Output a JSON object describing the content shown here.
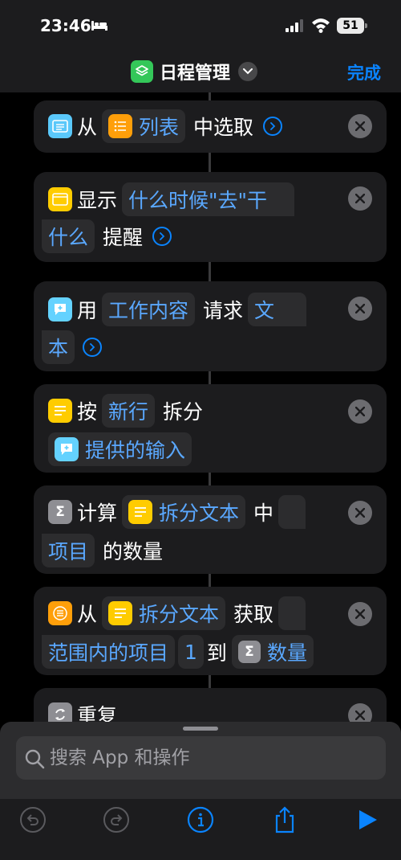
{
  "status_bar": {
    "time": "23:46",
    "battery": "51"
  },
  "nav": {
    "title": "日程管理",
    "done_label": "完成"
  },
  "actions": [
    {
      "text1": "从",
      "token1": "列表",
      "text2": "中选取"
    },
    {
      "text1": "显示",
      "token1_line1": "什么时候\"去\"干",
      "token1_line2": "什么",
      "text2": "提醒"
    },
    {
      "text1": "用",
      "token1": "工作内容",
      "text2": "请求",
      "token2_line1": "文",
      "token2_line2": "本"
    },
    {
      "text1": "按",
      "token1": "新行",
      "text2": "拆分",
      "token2": "提供的输入"
    },
    {
      "text1": "计算",
      "token1": "拆分文本",
      "text2": "中",
      "token2": "项目",
      "text3": "的数量"
    },
    {
      "text1": "从",
      "token1": "拆分文本",
      "text2": "获取",
      "token2": "范围内的项目",
      "token3": "1",
      "text3": "到",
      "token4": "数量"
    },
    {
      "text1": "重复"
    }
  ],
  "search": {
    "placeholder": "搜索 App 和操作"
  },
  "icons": {
    "sigma": "Σ",
    "close": "close-icon",
    "chevron": "chevron-right-icon"
  },
  "colors": {
    "accent": "#0a84ff",
    "token_text": "#5aa8ff",
    "card_bg": "#1c1c1e"
  }
}
